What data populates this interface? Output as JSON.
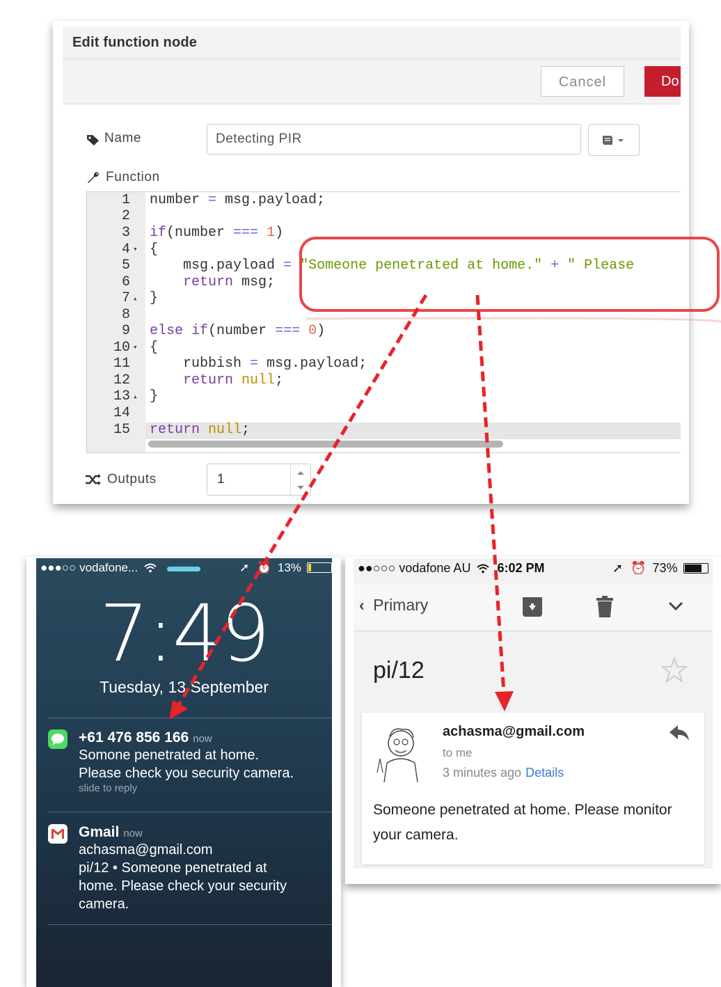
{
  "editor": {
    "title": "Edit function node",
    "cancel_label": "Cancel",
    "done_label": "Do",
    "name_label": "Name",
    "name_value": "Detecting PIR",
    "function_label": "Function",
    "outputs_label": "Outputs",
    "outputs_value": "1",
    "line_numbers": [
      "1",
      "2",
      "3",
      "4",
      "5",
      "6",
      "7",
      "8",
      "9",
      "10",
      "11",
      "12",
      "13",
      "14",
      "15"
    ],
    "code": {
      "l1a": "number",
      "l1b": " = ",
      "l1c": "msg.payload;",
      "l3a": "if",
      "l3b": "(number ",
      "l3c": "===",
      "l3d": " ",
      "l3e": "1",
      "l3f": ")",
      "l4": "{",
      "l5a": "    msg.payload ",
      "l5b": "=",
      "l5c": " ",
      "l5d": "\"Someone penetrated at home.\"",
      "l5e": " + ",
      "l5f": "\" Please",
      "l6a": "    return",
      "l6b": " msg;",
      "l7": "}",
      "l9a": "else",
      "l9b": " ",
      "l9c": "if",
      "l9d": "(number ",
      "l9e": "===",
      "l9f": " ",
      "l9g": "0",
      "l9h": ")",
      "l10": "{",
      "l11a": "    rubbish ",
      "l11b": "=",
      "l11c": " msg.payload;",
      "l12a": "    return",
      "l12b": " ",
      "l12c": "null",
      "l12d": ";",
      "l13": "}",
      "l15a": "return",
      "l15b": " ",
      "l15c": "null",
      "l15d": ";"
    }
  },
  "lockscreen": {
    "carrier": "●●●○○ vodafone...",
    "battery": "13%",
    "time": "7:49",
    "date": "Tuesday, 13 September",
    "notifications": [
      {
        "title": "+61 476 856 166",
        "when": "now",
        "line1": "Somone penetrated at home.",
        "line2": "Please check you security camera.",
        "hint": "slide to reply"
      },
      {
        "title": "Gmail",
        "when": "now",
        "line1": "achasma@gmail.com",
        "line2": "pi/12  •  Someone penetrated at",
        "line3": "home. Please check your security",
        "line4": "camera."
      }
    ]
  },
  "gmail": {
    "carrier": "●●○○○ vodafone AU",
    "time": "6:02 PM",
    "battery": "73%",
    "back_label": "Primary",
    "subject": "pi/12",
    "from": "achasma@gmail.com",
    "to": "to me",
    "when": "3 minutes ago",
    "details": "Details",
    "body": "Someone penetrated at home. Please monitor your camera."
  },
  "colors": {
    "done_button": "#c41e2c",
    "highlight": "#e8484a",
    "arrow": "#e8232a",
    "messages_green": "#4cd964",
    "gmail_red": "#d44638",
    "link_blue": "#3b7ad8"
  }
}
